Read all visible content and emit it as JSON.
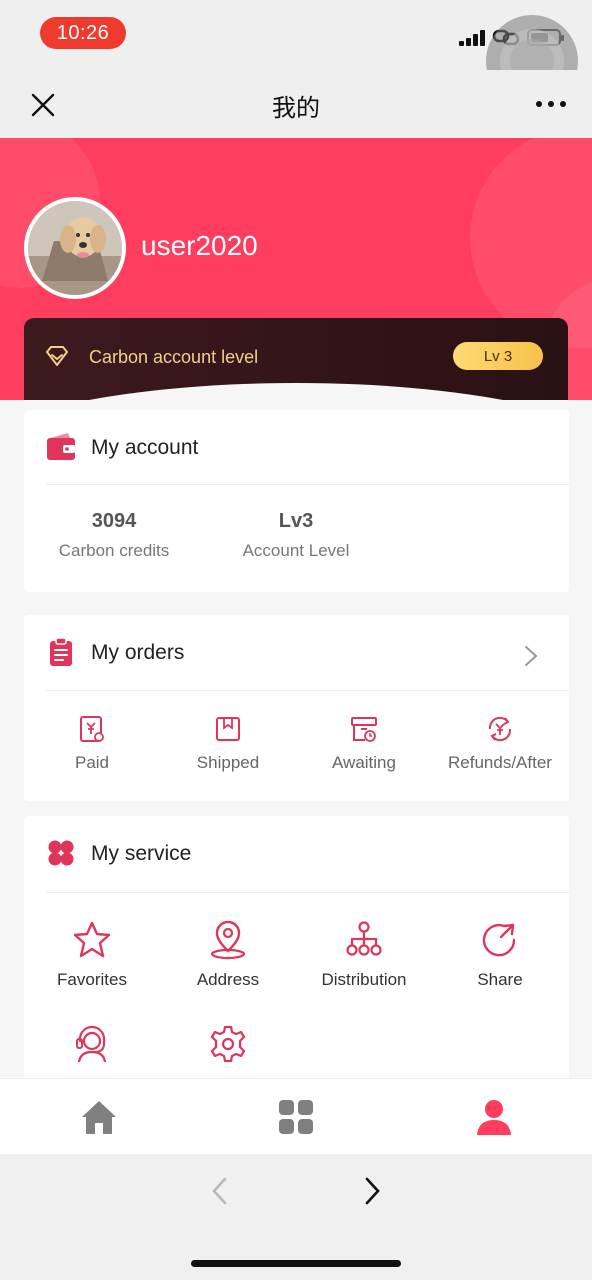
{
  "status": {
    "time": "10:26"
  },
  "nav": {
    "title": "我的"
  },
  "profile": {
    "username": "user2020"
  },
  "carbon": {
    "label": "Carbon account level",
    "level_badge": "Lv 3"
  },
  "account": {
    "title": "My account",
    "items": [
      {
        "value": "3094",
        "label": "Carbon credits"
      },
      {
        "value": "Lv3",
        "label": "Account Level"
      }
    ]
  },
  "orders": {
    "title": "My orders",
    "items": [
      {
        "label": "Paid",
        "icon": "paid-icon"
      },
      {
        "label": "Shipped",
        "icon": "shipped-icon"
      },
      {
        "label": "Awaiting",
        "icon": "awaiting-icon"
      },
      {
        "label": "Refunds/After",
        "icon": "refund-icon"
      }
    ]
  },
  "service": {
    "title": "My service",
    "items": [
      {
        "label": "Favorites",
        "icon": "star-icon"
      },
      {
        "label": "Address",
        "icon": "location-pin-icon"
      },
      {
        "label": "Distribution",
        "icon": "hierarchy-icon"
      },
      {
        "label": "Share",
        "icon": "share-icon"
      },
      {
        "label": "",
        "icon": "customer-service-icon"
      },
      {
        "label": "",
        "icon": "settings-gear-icon"
      }
    ]
  },
  "tabbar": {
    "items": [
      {
        "icon": "home-icon",
        "active": false
      },
      {
        "icon": "grid-apps-icon",
        "active": false
      },
      {
        "icon": "user-profile-icon",
        "active": true
      }
    ]
  },
  "colors": {
    "accent": "#ff3d5e",
    "icon_accent": "#e0355a",
    "gold": "#f2d08c",
    "inactive_tab": "#808080"
  }
}
